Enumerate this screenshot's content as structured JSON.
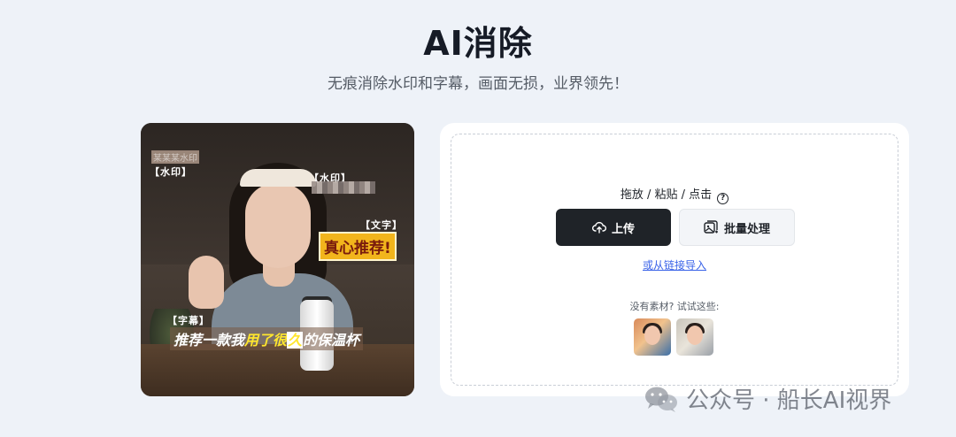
{
  "header": {
    "title": "AI消除",
    "subtitle": "无痕消除水印和字幕，画面无损，业界领先！"
  },
  "preview": {
    "watermark_text_1": "某某某水印",
    "label_watermark_1": "【水印】",
    "label_watermark_2": "【水印】",
    "label_text": "【文字】",
    "badge_text": "真心推荐!",
    "label_subtitle": "【字幕】",
    "subtitle_parts": {
      "before": "推荐一款我",
      "highlight": "用了很",
      "boxed": "久",
      "after": "的保温杯"
    }
  },
  "upload": {
    "drop_hint": "拖放 / 粘贴 / 点击",
    "help_icon_glyph": "?",
    "upload_label": "上传",
    "batch_label": "批量处理",
    "import_link": "或从链接导入",
    "try_label": "没有素材? 试试这些:",
    "sample_images": [
      "sample-1",
      "sample-2"
    ]
  },
  "watermark": {
    "text": "公众号 · 船长AI视界"
  },
  "colors": {
    "background": "#eef2f8",
    "primary_button": "#1f2328",
    "link": "#3a63e8"
  }
}
